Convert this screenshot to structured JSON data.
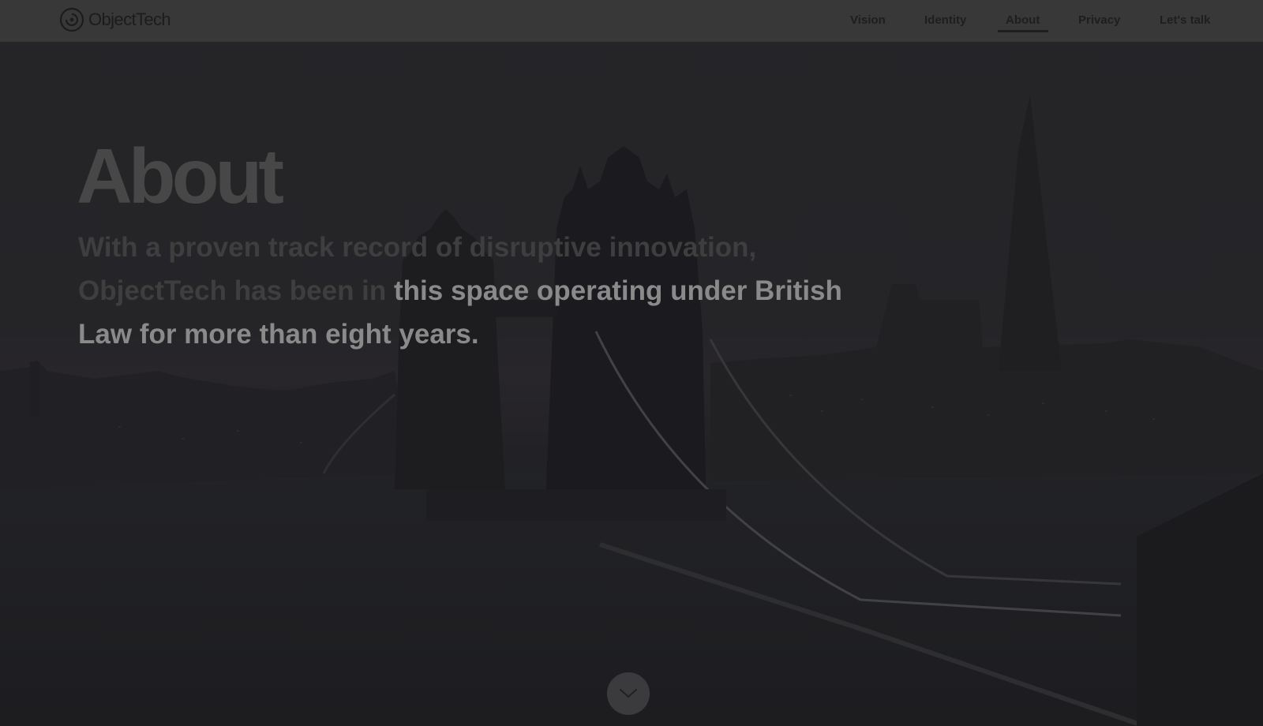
{
  "brand": {
    "name": "ObjectTech",
    "logo_icon": "spiral-logo-icon"
  },
  "nav": {
    "items": [
      {
        "label": "Vision",
        "active": false
      },
      {
        "label": "Identity",
        "active": false
      },
      {
        "label": "About",
        "active": true
      },
      {
        "label": "Privacy",
        "active": false
      },
      {
        "label": "Let's talk",
        "active": false
      }
    ]
  },
  "hero": {
    "title": "About",
    "text_parts": [
      "With a proven track record of disruptive innovation, ObjectTech has been in ",
      "this space operating under British Law for more than eight years.",
      ""
    ],
    "background_subject": "Tower Bridge and London skyline at dusk",
    "scroll_icon": "chevron-down-icon"
  },
  "colors": {
    "header_bg": "#383838",
    "nav_text": "#1e1e1e",
    "overlay_dark": "#2b2b2e"
  }
}
